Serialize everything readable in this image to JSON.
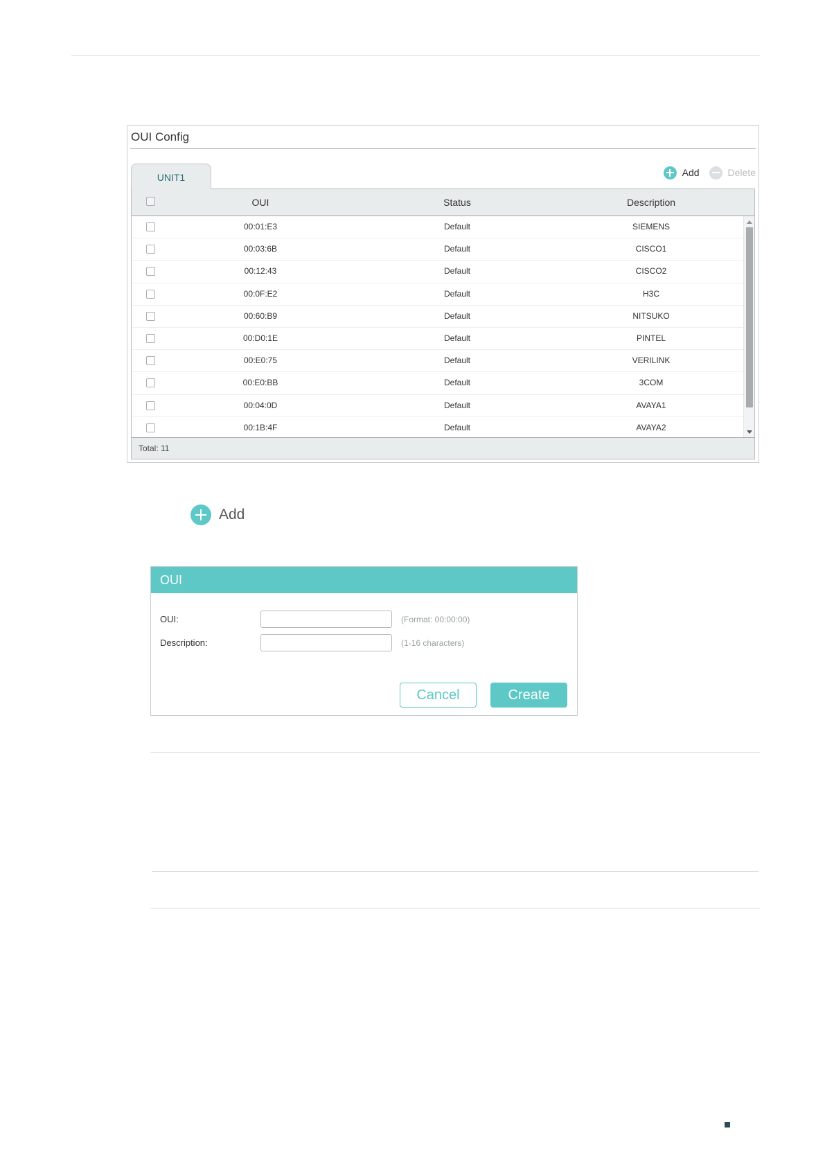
{
  "oui_config": {
    "title": "OUI Config",
    "tab_label": "UNIT1",
    "toolbar": {
      "add_label": "Add",
      "delete_label": "Delete"
    },
    "columns": [
      "OUI",
      "Status",
      "Description"
    ],
    "rows": [
      {
        "oui": "00:01:E3",
        "status": "Default",
        "description": "SIEMENS"
      },
      {
        "oui": "00:03:6B",
        "status": "Default",
        "description": "CISCO1"
      },
      {
        "oui": "00:12:43",
        "status": "Default",
        "description": "CISCO2"
      },
      {
        "oui": "00:0F:E2",
        "status": "Default",
        "description": "H3C"
      },
      {
        "oui": "00:60:B9",
        "status": "Default",
        "description": "NITSUKO"
      },
      {
        "oui": "00:D0:1E",
        "status": "Default",
        "description": "PINTEL"
      },
      {
        "oui": "00:E0:75",
        "status": "Default",
        "description": "VERILINK"
      },
      {
        "oui": "00:E0:BB",
        "status": "Default",
        "description": "3COM"
      },
      {
        "oui": "00:04:0D",
        "status": "Default",
        "description": "AVAYA1"
      },
      {
        "oui": "00:1B:4F",
        "status": "Default",
        "description": "AVAYA2"
      }
    ],
    "total_text": "Total: 11"
  },
  "big_add": {
    "label": "Add"
  },
  "dialog": {
    "title": "OUI",
    "oui_label": "OUI:",
    "oui_value": "",
    "oui_hint": "(Format: 00:00:00)",
    "description_label": "Description:",
    "description_value": "",
    "description_hint": "(1-16 characters)",
    "cancel_label": "Cancel",
    "create_label": "Create"
  },
  "colors": {
    "accent": "#5dc8c6",
    "header_bg": "#e9eced",
    "disabled": "#b8bcbf"
  },
  "icons": {
    "add": "plus-circle-icon",
    "delete": "minus-circle-icon"
  }
}
